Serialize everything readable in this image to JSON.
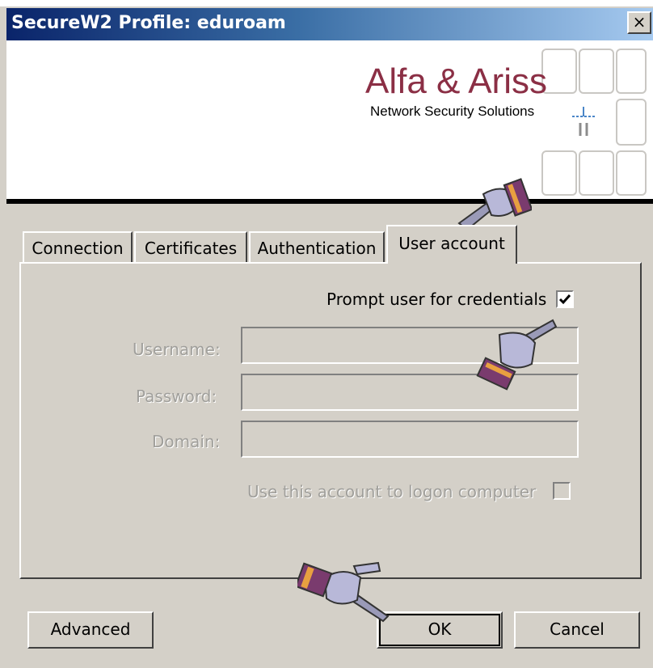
{
  "window": {
    "title": "SecureW2 Profile: eduroam",
    "close_glyph": "×"
  },
  "banner": {
    "brand": "Alfa & Ariss",
    "tagline": "Network Security Solutions",
    "brand_color": "#8b2f45"
  },
  "tabs": [
    {
      "label": "Connection"
    },
    {
      "label": "Certificates"
    },
    {
      "label": "Authentication"
    },
    {
      "label": "User account",
      "active": true
    }
  ],
  "user_account": {
    "prompt_label": "Prompt user for credentials",
    "prompt_checked": true,
    "username_label": "Username:",
    "username_value": "",
    "password_label": "Password:",
    "password_value": "",
    "domain_label": "Domain:",
    "domain_value": "",
    "logon_label": "Use this account to logon computer",
    "logon_checked": false
  },
  "buttons": {
    "advanced": "Advanced",
    "ok": "OK",
    "cancel": "Cancel"
  },
  "annotations": {
    "pointer_icon": "pointing-hand-icon"
  }
}
